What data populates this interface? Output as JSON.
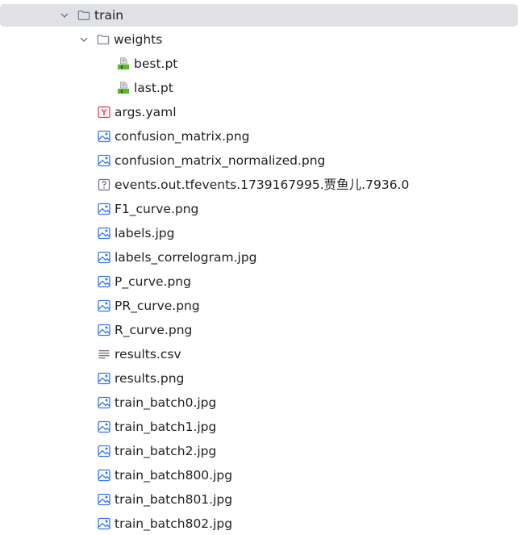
{
  "tree": {
    "root": {
      "label": "train",
      "icon": "folder-icon",
      "expanded": true
    },
    "weights": {
      "label": "weights",
      "icon": "folder-icon",
      "expanded": true,
      "children": [
        {
          "label": "best.pt",
          "icon": "python-data-file-icon"
        },
        {
          "label": "last.pt",
          "icon": "python-data-file-icon"
        }
      ]
    },
    "files": [
      {
        "label": "args.yaml",
        "icon": "yaml-file-icon"
      },
      {
        "label": "confusion_matrix.png",
        "icon": "image-file-icon"
      },
      {
        "label": "confusion_matrix_normalized.png",
        "icon": "image-file-icon"
      },
      {
        "label": "events.out.tfevents.1739167995.贾鱼儿.7936.0",
        "icon": "unknown-file-icon"
      },
      {
        "label": "F1_curve.png",
        "icon": "image-file-icon"
      },
      {
        "label": "labels.jpg",
        "icon": "image-file-icon"
      },
      {
        "label": "labels_correlogram.jpg",
        "icon": "image-file-icon"
      },
      {
        "label": "P_curve.png",
        "icon": "image-file-icon"
      },
      {
        "label": "PR_curve.png",
        "icon": "image-file-icon"
      },
      {
        "label": "R_curve.png",
        "icon": "image-file-icon"
      },
      {
        "label": "results.csv",
        "icon": "text-file-icon"
      },
      {
        "label": "results.png",
        "icon": "image-file-icon"
      },
      {
        "label": "train_batch0.jpg",
        "icon": "image-file-icon"
      },
      {
        "label": "train_batch1.jpg",
        "icon": "image-file-icon"
      },
      {
        "label": "train_batch2.jpg",
        "icon": "image-file-icon"
      },
      {
        "label": "train_batch800.jpg",
        "icon": "image-file-icon"
      },
      {
        "label": "train_batch801.jpg",
        "icon": "image-file-icon"
      },
      {
        "label": "train_batch802.jpg",
        "icon": "image-file-icon"
      }
    ]
  },
  "colors": {
    "selection": "#dfe1e5",
    "image_icon": "#3574f0",
    "yaml_icon": "#db3b4b",
    "pt_icon_green": "#5fb832",
    "chevron": "#6c707e"
  }
}
